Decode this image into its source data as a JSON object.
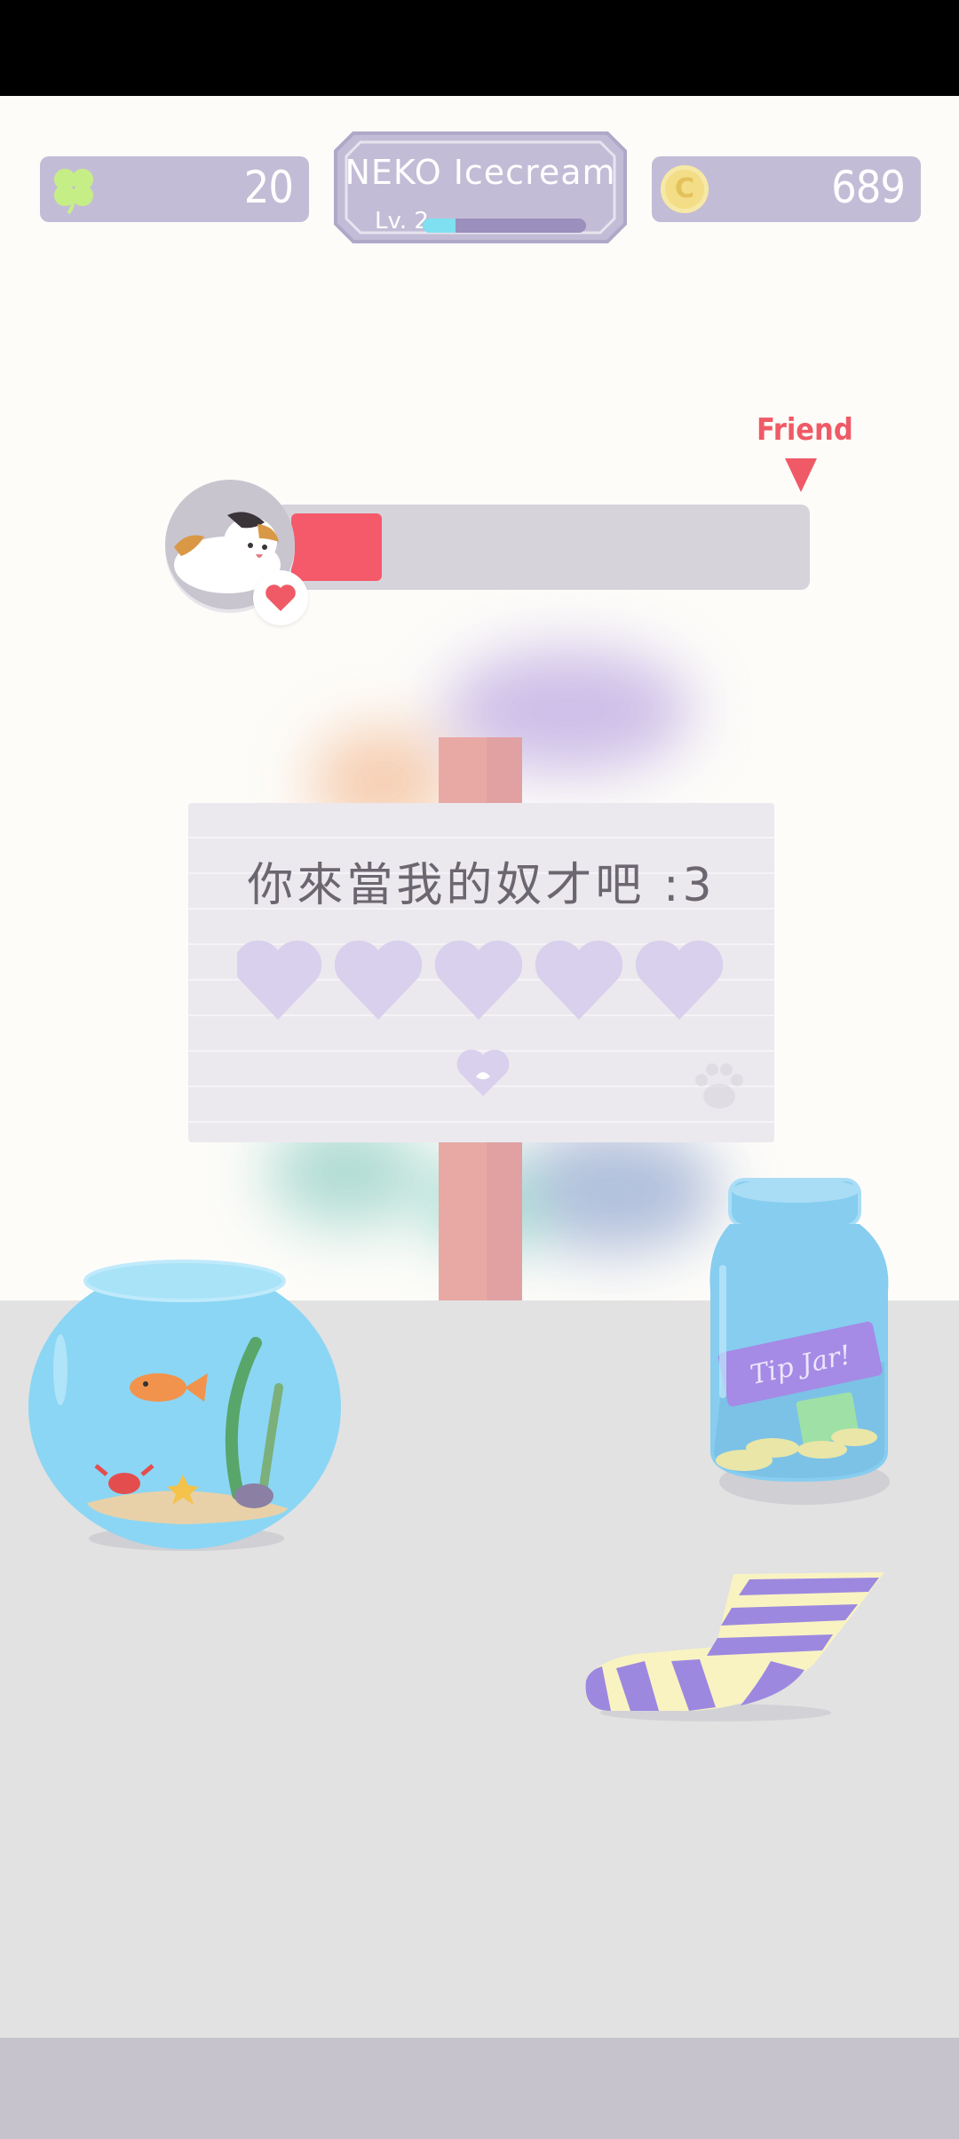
{
  "hud": {
    "clover_count": "20",
    "coin_count": "689",
    "coin_symbol": "C",
    "title": "NEKO Icecream",
    "level_label": "Lv. 2",
    "level_progress": 0.2
  },
  "affection": {
    "friend_label": "Friend",
    "progress": 0.18
  },
  "sign": {
    "message": "你來當我的奴才吧 :3",
    "hearts_total": 5,
    "hearts_filled": 0
  },
  "scene": {
    "jar_label": "Tip Jar!"
  },
  "colors": {
    "hud_pill": "#c3bcd6",
    "affection_fill": "#f55a6a",
    "friend_accent": "#ef5a66",
    "heart_empty": "#d8d0ec",
    "floor": "#e2e2e2"
  }
}
